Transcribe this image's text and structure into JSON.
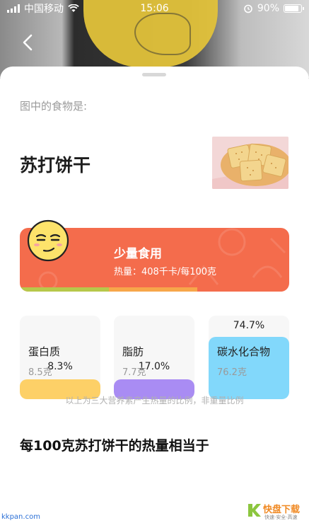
{
  "status": {
    "carrier": "中国移动",
    "time": "15:06",
    "battery": "90%"
  },
  "sheet": {
    "prompt": "图中的食物是:",
    "food_name": "苏打饼干",
    "advice": {
      "title": "少量食用",
      "calories": "热量：408千卡/每100克",
      "bar_colors": [
        "#b7c84a",
        "#f7a64a",
        "#f46c4c"
      ]
    },
    "nutrients": [
      {
        "name": "蛋白质",
        "amount": "8.5克",
        "percent": "8.3%",
        "share": 0.083,
        "color": "#fdd067"
      },
      {
        "name": "脂肪",
        "amount": "7.7克",
        "percent": "17.0%",
        "share": 0.17,
        "color": "#a98cf3"
      },
      {
        "name": "碳水化合物",
        "amount": "76.2克",
        "percent": "74.7%",
        "share": 0.747,
        "color": "#82d8fb"
      }
    ],
    "note": "以上为三大营养素产生热量的比例，非重量比例",
    "equivalent_title": "每100克苏打饼干的热量相当于"
  },
  "watermark": {
    "left": "kkpan.com",
    "brand": "快盘下载",
    "slogan": "快速·安全·高速"
  }
}
